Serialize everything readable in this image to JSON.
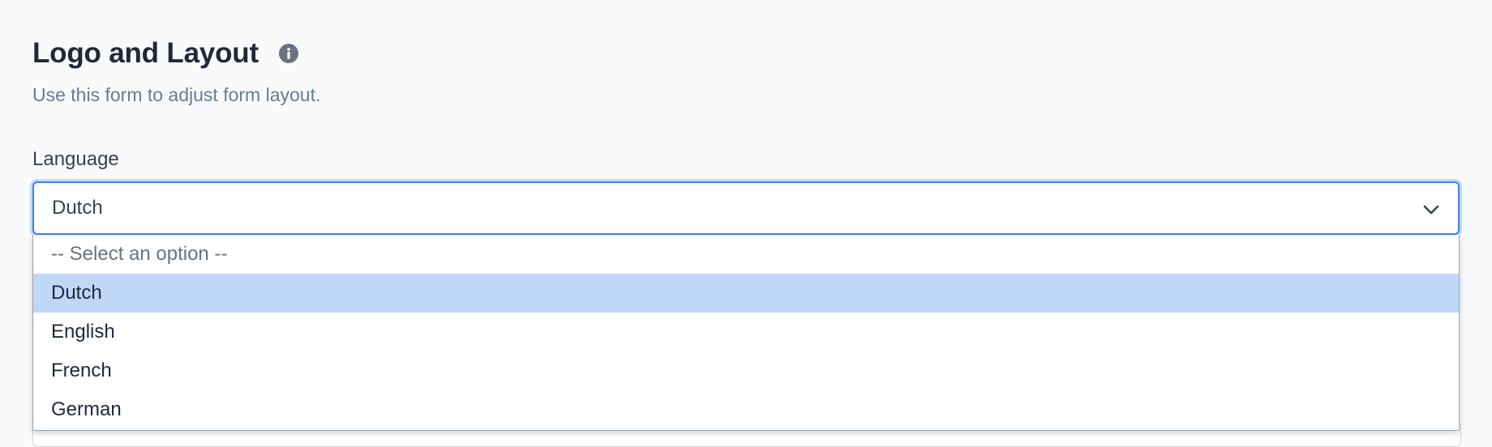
{
  "header": {
    "title": "Logo and Layout",
    "subtitle": "Use this form to adjust form layout."
  },
  "icons": {
    "info": "info-circle-icon",
    "chevron": "chevron-down-icon"
  },
  "language_field": {
    "label": "Language",
    "selected_value": "Dutch",
    "options": [
      "-- Select an option --",
      "Dutch",
      "English",
      "French",
      "German"
    ]
  },
  "colors": {
    "focus_border": "#3b82f6",
    "selected_option_bg": "#bfd8f8"
  }
}
